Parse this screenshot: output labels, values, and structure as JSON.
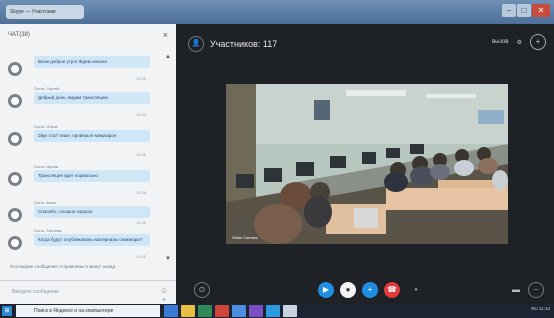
{
  "window": {
    "title_tab": "Skype — Участники"
  },
  "chat": {
    "header": "ЧАТ(38)",
    "messages": [
      {
        "meta": "",
        "text": "Всем доброе утро! Ждем начала",
        "time": "11:02"
      },
      {
        "meta": "Гость: Сергей",
        "text": "Добрый день, видим трансляцию",
        "time": "11:04"
      },
      {
        "meta": "Гость: Ольга",
        "text": "Звук стал тише, проверьте микрофон",
        "time": "11:06"
      },
      {
        "meta": "Гость: Ирина",
        "text": "Трансляция идет нормально",
        "time": "11:08"
      },
      {
        "meta": "Гость: Анна",
        "text": "Спасибо, слышно хорошо",
        "time": "11:10"
      },
      {
        "meta": "Гость: Татьяна",
        "text": "Когда будут опубликованы материалы семинара?",
        "time": "11:12"
      }
    ],
    "status": "Последние сообщения отправлены 5 минут назад",
    "input_placeholder": "Введите сообщение"
  },
  "call": {
    "participants_label": "Участников: 117",
    "top_right_label": "вызов",
    "video_label": "Video Camera"
  },
  "taskbar": {
    "search_placeholder": "Поиск в Яндексе и на компьютере",
    "tray_text": "RU 11:14"
  },
  "colors": {
    "accent": "#1f8ee0",
    "end_call": "#e03a3a",
    "chat_bubble": "#cfe6f7"
  }
}
